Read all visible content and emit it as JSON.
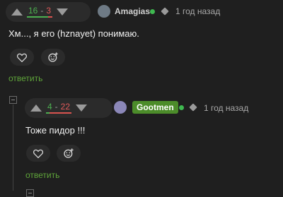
{
  "comment1": {
    "score_plus": "16",
    "score_sep": "-",
    "score_minus": "3",
    "username": "Amagias",
    "time": "1 год назад",
    "text": "Хм..., я его (hznayet) понимаю.",
    "reply_label": "ответить"
  },
  "comment2": {
    "score_plus": "4",
    "score_sep": "-",
    "score_minus": "22",
    "username": "Gootmen",
    "time": "1 год назад",
    "text": "Тоже пидор !!!",
    "reply_label": "ответить"
  },
  "colors": {
    "plus": "#4caf50",
    "minus": "#e05a5a",
    "accent": "#5fa53a",
    "badge": "#4c8c2a"
  },
  "icons": {
    "like": "heart-icon",
    "react": "emoji-add-icon",
    "collapse": "minus-box-icon"
  }
}
